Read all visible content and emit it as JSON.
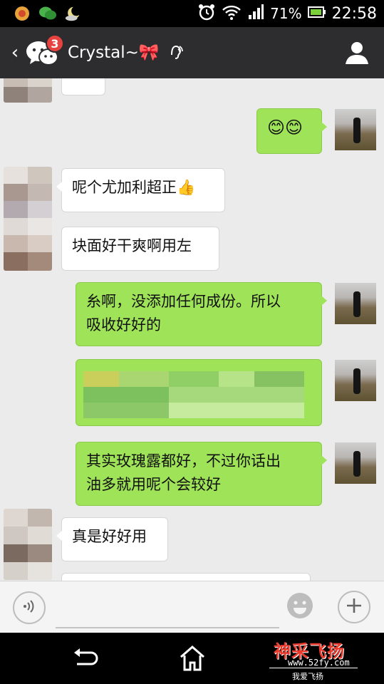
{
  "status_bar": {
    "battery_percent": "71%",
    "time": "22:58"
  },
  "header": {
    "back_label": "‹",
    "unread_count": "3",
    "title": "Crystal~🎀"
  },
  "messages": [
    {
      "side": "in",
      "text": ""
    },
    {
      "side": "out",
      "text": "😊😊"
    },
    {
      "side": "in",
      "text": "呢个尤加利超正👍"
    },
    {
      "side": "in",
      "text": "块面好干爽啊用左"
    },
    {
      "side": "out",
      "text": "糸啊，没添加任何成份。所以吸收好好的"
    },
    {
      "side": "out",
      "text": ""
    },
    {
      "side": "out",
      "text": "其实玫瑰露都好，不过你话出油多就用呢个会较好"
    },
    {
      "side": "in",
      "text": "真是好好用"
    }
  ],
  "message_lines": {
    "m3_l1": "糸啊，没添加任何成份。所以",
    "m3_l2": "吸收好好的",
    "m5_l1": "其实玫瑰露都好，不过你话出",
    "m5_l2": "油多就用呢个会较好"
  },
  "input": {
    "placeholder": ""
  },
  "watermark": {
    "title": "神采飞扬",
    "url": "www.52fy.com",
    "sub": "我爱飞扬"
  },
  "colors": {
    "titlebar": "#2d2d2f",
    "chat_bg": "#ebebeb",
    "out_bubble": "#9fe358",
    "in_bubble": "#ffffff",
    "badge": "#e64340"
  }
}
